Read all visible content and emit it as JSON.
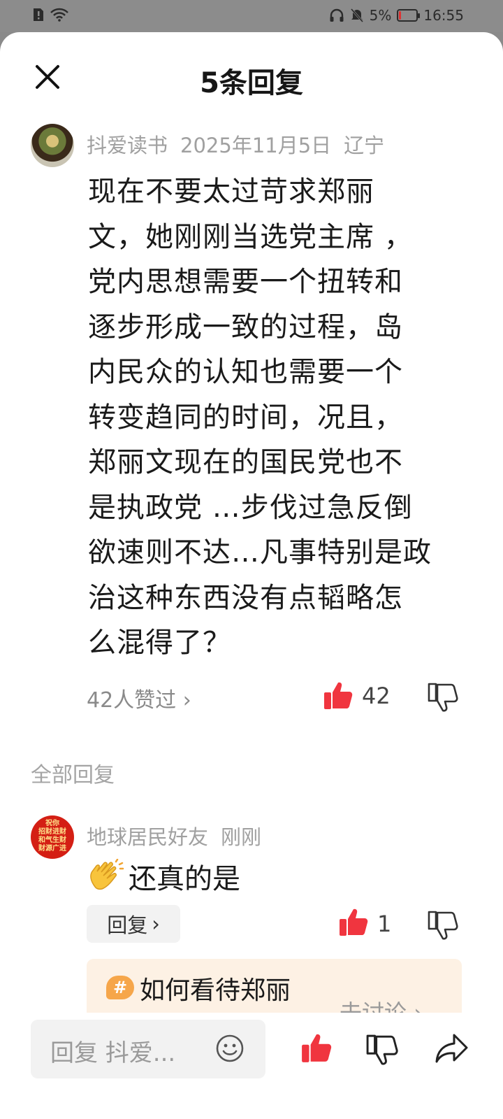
{
  "status": {
    "battery": "5%",
    "time": "16:55",
    "battery_level": 0.05
  },
  "sheet": {
    "title": "5条回复"
  },
  "main_comment": {
    "author": "抖爱读书",
    "date": "2025年11月5日",
    "location": "辽宁",
    "lines": [
      "现在不要太过苛求郑丽",
      "文，她刚刚当选党主席 ，",
      "党内思想需要一个扭转和",
      "逐步形成一致的过程，岛",
      "内民众的认知也需要一个",
      "转变趋同的时间，况且，",
      "郑丽文现在的国民党也不",
      "是执政党 …步伐过急反倒",
      "欲速则不达…凡事特别是政",
      "治这种东西没有点韬略怎",
      "么混得了？"
    ],
    "liked_by": "42人赞过",
    "like_count": "42"
  },
  "section_title": "全部回复",
  "reply": {
    "author": "地球居民好友",
    "time": "刚刚",
    "text": "还真的是",
    "reply_label": "回复",
    "like_count": "1",
    "avatar_lines": [
      "祝你",
      "招财进财",
      "和气生财",
      "财源广进"
    ]
  },
  "topic": {
    "badge": "#",
    "text": "如何看待郑丽",
    "link": "去讨论 ›"
  },
  "bottom": {
    "input_placeholder": "回复 抖爱..."
  },
  "colors": {
    "like_red": "#f0353f",
    "topic_bg": "#fdf1e4"
  }
}
